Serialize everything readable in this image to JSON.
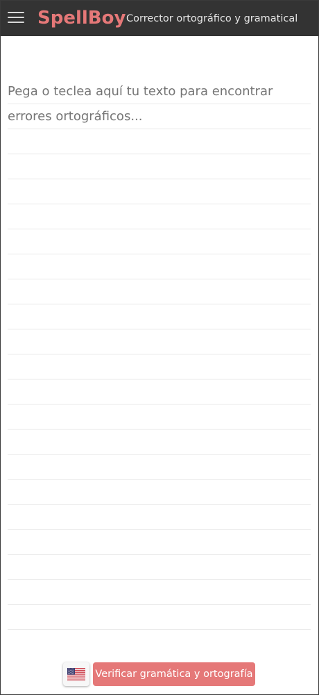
{
  "header": {
    "menu_icon": "hamburger-menu-icon",
    "brand": "SpellBoy",
    "tagline": "Corrector ortográfico y gramatical",
    "background_color": "#333333",
    "brand_color": "#e57878"
  },
  "editor": {
    "placeholder": "Pega o teclea aquí tu texto para encontrar errores ortográficos...",
    "value": ""
  },
  "footer": {
    "language_icon": "us-flag-icon",
    "check_button_label": "Verificar gramática y ortografía",
    "button_color": "#e57878"
  }
}
